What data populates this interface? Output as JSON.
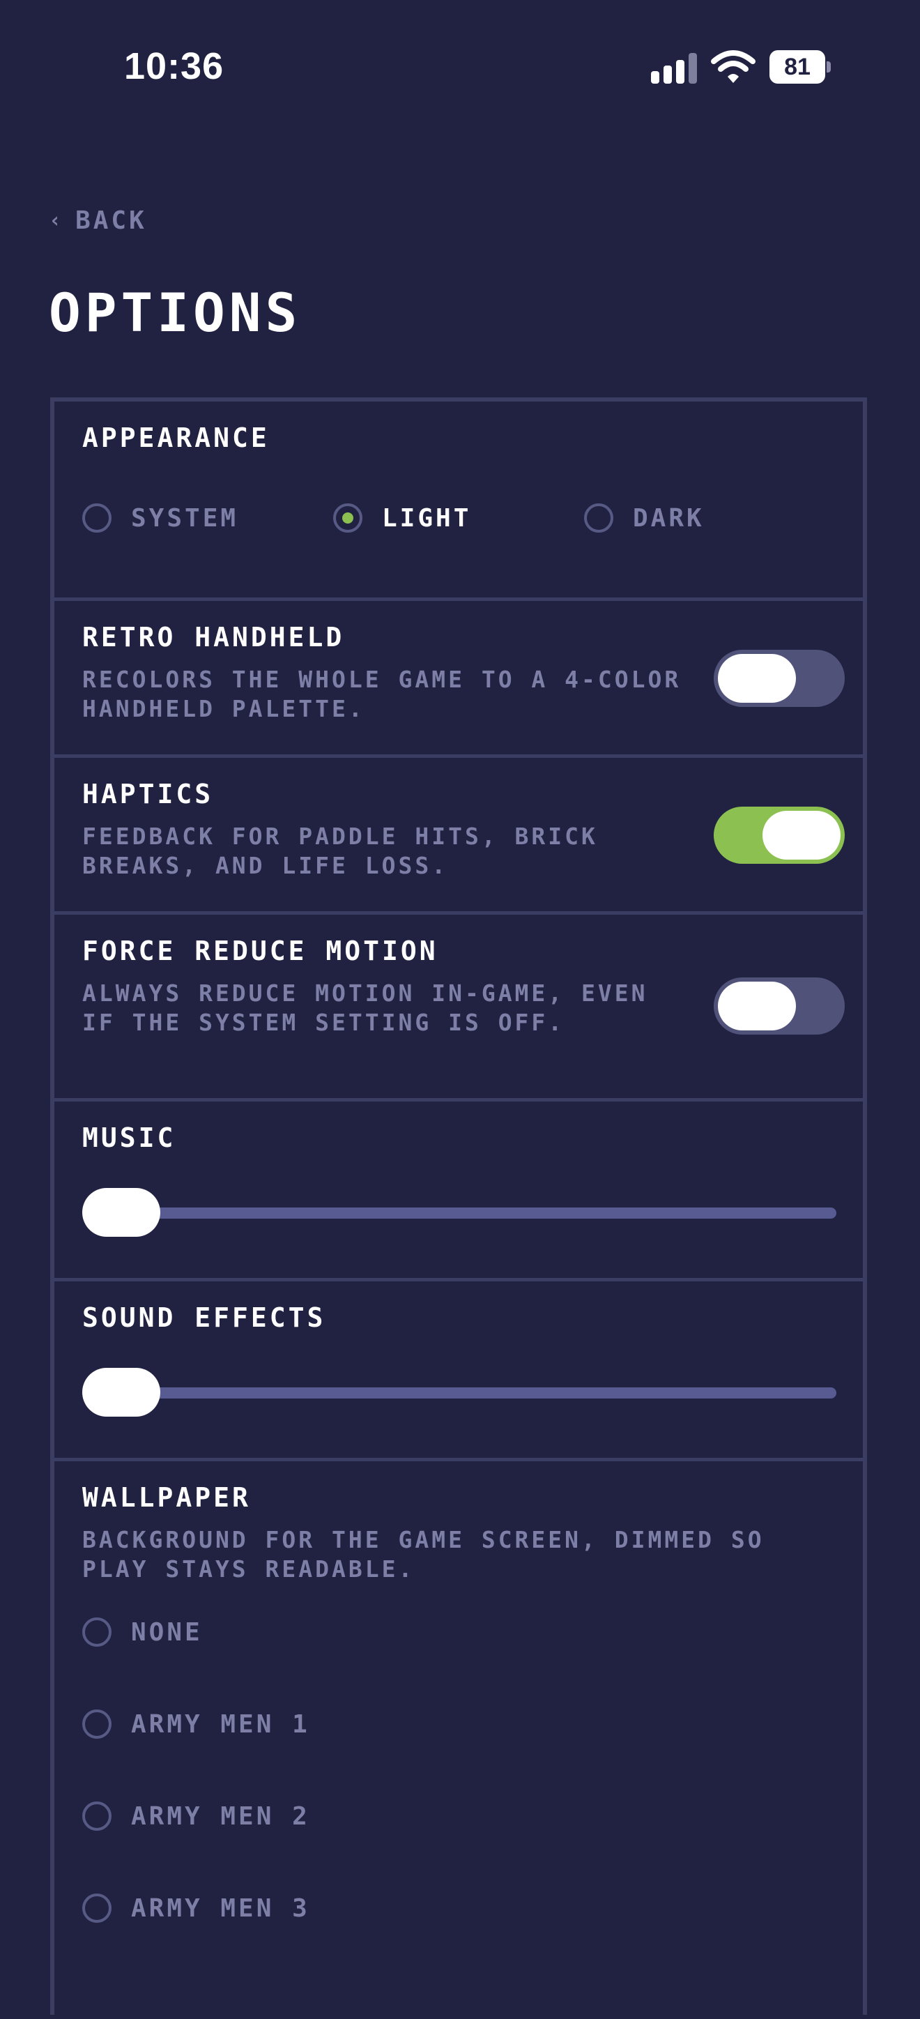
{
  "status_bar": {
    "time": "10:36",
    "battery": "81"
  },
  "nav": {
    "back_label": "BACK",
    "back_icon": "chevron-left-icon"
  },
  "page": {
    "title": "OPTIONS"
  },
  "appearance": {
    "title": "APPEARANCE",
    "options": [
      {
        "label": "SYSTEM",
        "selected": false
      },
      {
        "label": "LIGHT",
        "selected": true
      },
      {
        "label": "DARK",
        "selected": false
      }
    ]
  },
  "retro_handheld": {
    "title": "RETRO HANDHELD",
    "description": "RECOLORS THE WHOLE GAME TO A 4-COLOR HANDHELD PALETTE.",
    "enabled": false
  },
  "haptics": {
    "title": "HAPTICS",
    "description": "FEEDBACK FOR PADDLE HITS, BRICK BREAKS, AND LIFE LOSS.",
    "enabled": true
  },
  "force_reduce_motion": {
    "title": "FORCE REDUCE MOTION",
    "description": "ALWAYS REDUCE MOTION IN-GAME, EVEN IF THE SYSTEM SETTING IS OFF.",
    "enabled": false
  },
  "music": {
    "title": "MUSIC",
    "value": 0
  },
  "sound_effects": {
    "title": "SOUND EFFECTS",
    "value": 0
  },
  "wallpaper": {
    "title": "WALLPAPER",
    "description": "BACKGROUND FOR THE GAME SCREEN, DIMMED SO PLAY STAYS READABLE.",
    "options": [
      {
        "label": "NONE",
        "selected": false
      },
      {
        "label": "ARMY MEN 1",
        "selected": false
      },
      {
        "label": "ARMY MEN 2",
        "selected": false
      },
      {
        "label": "ARMY MEN 3",
        "selected": false
      }
    ]
  },
  "colors": {
    "background": "#212241",
    "accent": "#8cc152",
    "muted_text": "#7d7fa6",
    "border": "#3c3d62"
  }
}
